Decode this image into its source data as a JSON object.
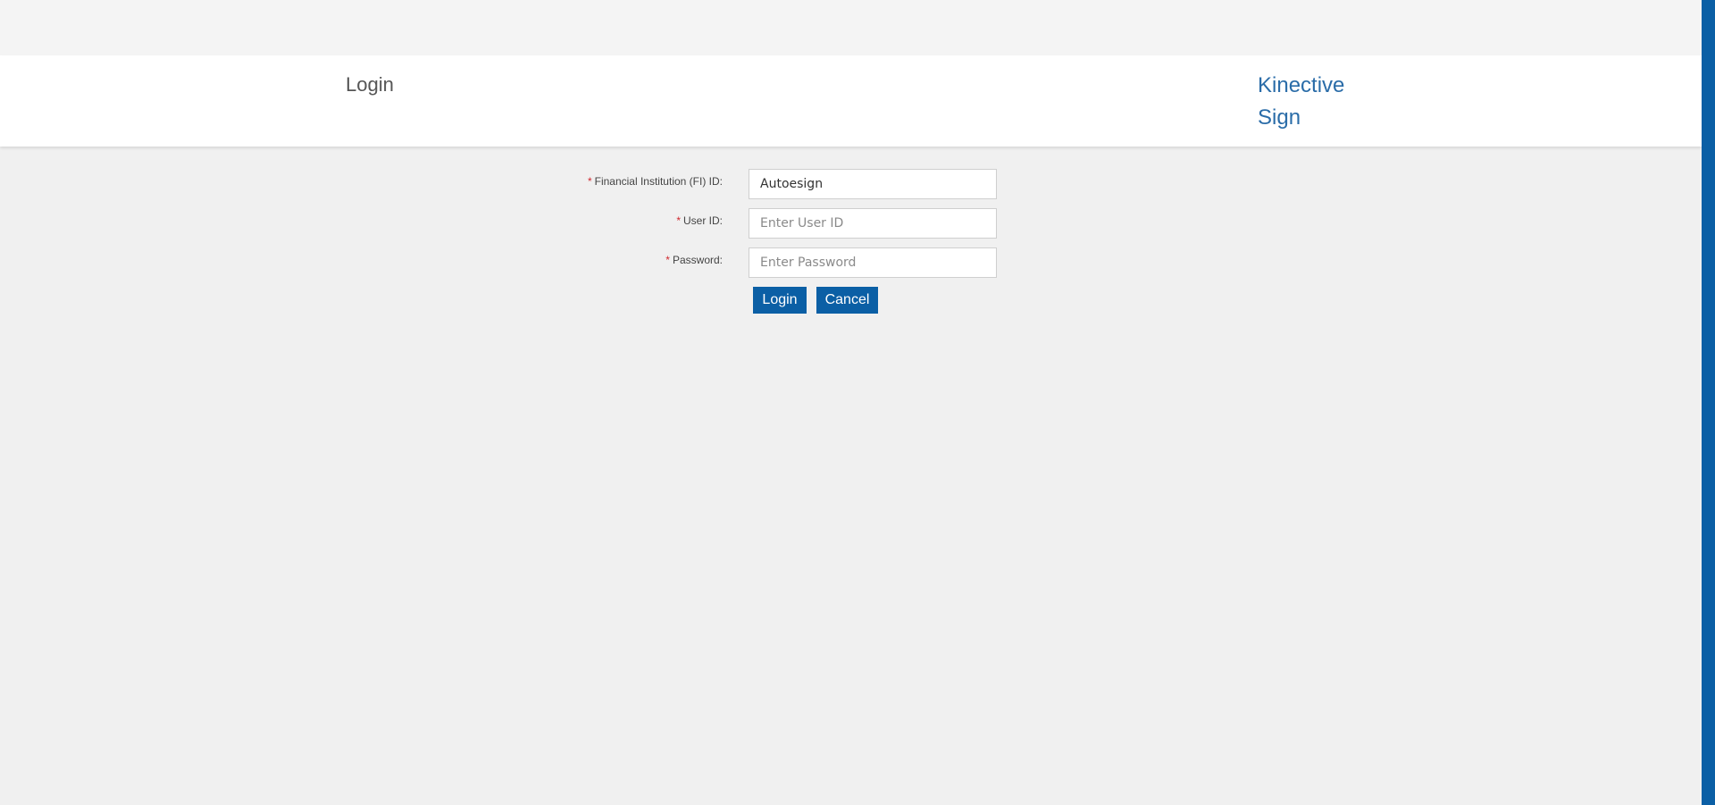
{
  "header": {
    "title": "Login",
    "brand_line1": "Kinective",
    "brand_line2": "Sign"
  },
  "form": {
    "required_marker": "*",
    "fi_id": {
      "label": "Financial Institution (FI) ID:",
      "value": "Autoesign",
      "placeholder": ""
    },
    "user_id": {
      "label": "User ID:",
      "value": "",
      "placeholder": "Enter User ID"
    },
    "password": {
      "label": "Password:",
      "value": "",
      "placeholder": "Enter Password"
    },
    "login_label": "Login",
    "cancel_label": "Cancel"
  },
  "colors": {
    "accent": "#0b5fa5",
    "brand_text": "#2a6ca8",
    "required": "#d0282e",
    "background": "#f0f0f0"
  }
}
